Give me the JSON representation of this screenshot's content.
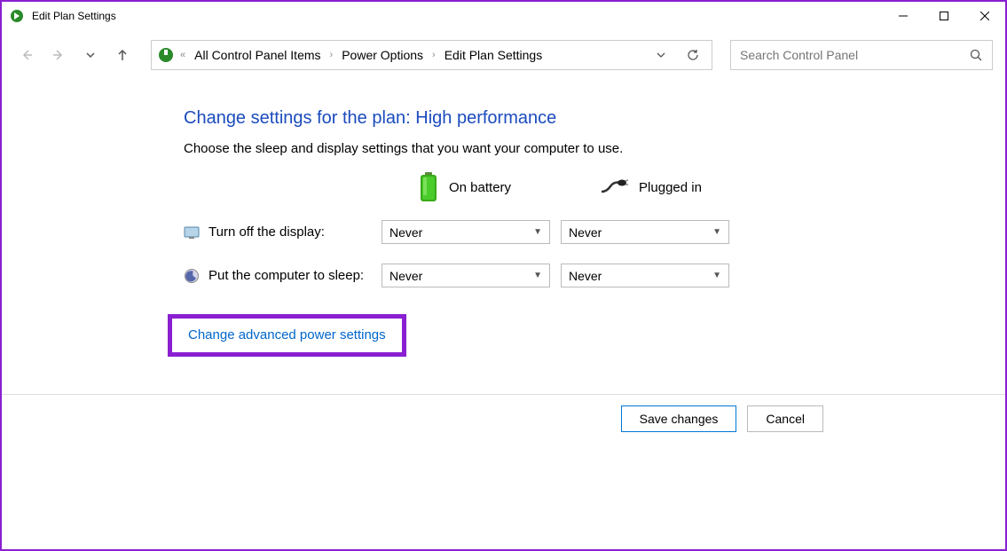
{
  "window": {
    "title": "Edit Plan Settings"
  },
  "breadcrumb": {
    "items": [
      "All Control Panel Items",
      "Power Options",
      "Edit Plan Settings"
    ]
  },
  "search": {
    "placeholder": "Search Control Panel"
  },
  "content": {
    "heading": "Change settings for the plan: High performance",
    "subtext": "Choose the sleep and display settings that you want your computer to use.",
    "columns": {
      "battery": "On battery",
      "plugged": "Plugged in"
    },
    "rows": [
      {
        "label": "Turn off the display:",
        "battery_value": "Never",
        "plugged_value": "Never"
      },
      {
        "label": "Put the computer to sleep:",
        "battery_value": "Never",
        "plugged_value": "Never"
      }
    ],
    "advanced_link": "Change advanced power settings"
  },
  "footer": {
    "save": "Save changes",
    "cancel": "Cancel"
  }
}
